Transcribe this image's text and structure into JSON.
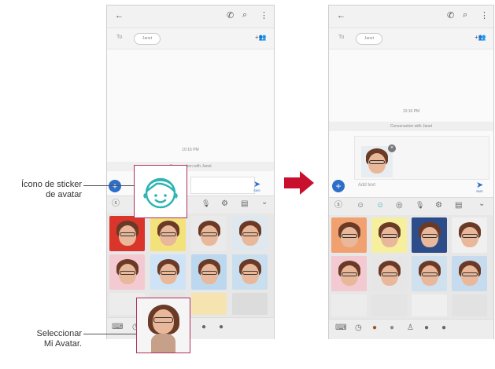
{
  "left_phone": {
    "to_label": "To",
    "recipient": "Janet",
    "timestamp": "10:16 PM",
    "conversation_banner": "Conversation with Janet",
    "send_sub": "SMS"
  },
  "right_phone": {
    "to_label": "To",
    "recipient": "Janet",
    "timestamp": "10:16 PM",
    "conversation_banner": "Conversation with Janet",
    "input_placeholder": "Add text",
    "send_sub": "SMS"
  },
  "annotations": {
    "sticker_icon_line1": "Ícono de sticker",
    "sticker_icon_line2": "de avatar",
    "select_avatar_line1": "Seleccionar",
    "select_avatar_line2": "Mi Avatar."
  },
  "icons": {
    "back": "←",
    "call": "✆",
    "search": "⌕",
    "more": "⋮",
    "add_contact": "+👥",
    "plus": "+",
    "send": "➤",
    "chevron": "⌄",
    "mic": "🎙",
    "gear": "⚙",
    "keyboard": "⌨",
    "clock": "◷"
  },
  "colors": {
    "accent_blue": "#2d6ec9",
    "callout_border": "#b0315b",
    "arrow_red": "#c8102e",
    "teal_icon": "#2fb3b3"
  }
}
